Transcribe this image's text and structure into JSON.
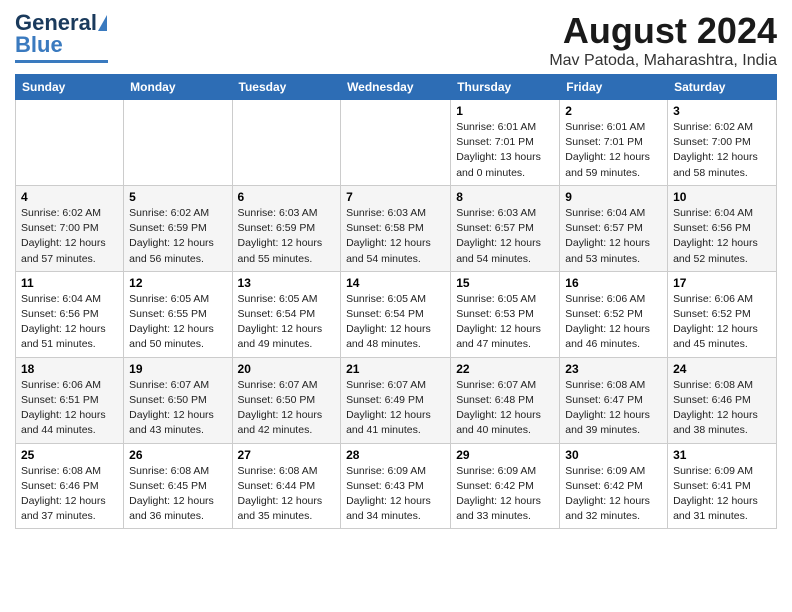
{
  "header": {
    "logo_general": "General",
    "logo_blue": "Blue",
    "month_year": "August 2024",
    "location": "Mav Patoda, Maharashtra, India"
  },
  "days_of_week": [
    "Sunday",
    "Monday",
    "Tuesday",
    "Wednesday",
    "Thursday",
    "Friday",
    "Saturday"
  ],
  "weeks": [
    [
      {
        "day": "",
        "info": ""
      },
      {
        "day": "",
        "info": ""
      },
      {
        "day": "",
        "info": ""
      },
      {
        "day": "",
        "info": ""
      },
      {
        "day": "1",
        "info": "Sunrise: 6:01 AM\nSunset: 7:01 PM\nDaylight: 13 hours\nand 0 minutes."
      },
      {
        "day": "2",
        "info": "Sunrise: 6:01 AM\nSunset: 7:01 PM\nDaylight: 12 hours\nand 59 minutes."
      },
      {
        "day": "3",
        "info": "Sunrise: 6:02 AM\nSunset: 7:00 PM\nDaylight: 12 hours\nand 58 minutes."
      }
    ],
    [
      {
        "day": "4",
        "info": "Sunrise: 6:02 AM\nSunset: 7:00 PM\nDaylight: 12 hours\nand 57 minutes."
      },
      {
        "day": "5",
        "info": "Sunrise: 6:02 AM\nSunset: 6:59 PM\nDaylight: 12 hours\nand 56 minutes."
      },
      {
        "day": "6",
        "info": "Sunrise: 6:03 AM\nSunset: 6:59 PM\nDaylight: 12 hours\nand 55 minutes."
      },
      {
        "day": "7",
        "info": "Sunrise: 6:03 AM\nSunset: 6:58 PM\nDaylight: 12 hours\nand 54 minutes."
      },
      {
        "day": "8",
        "info": "Sunrise: 6:03 AM\nSunset: 6:57 PM\nDaylight: 12 hours\nand 54 minutes."
      },
      {
        "day": "9",
        "info": "Sunrise: 6:04 AM\nSunset: 6:57 PM\nDaylight: 12 hours\nand 53 minutes."
      },
      {
        "day": "10",
        "info": "Sunrise: 6:04 AM\nSunset: 6:56 PM\nDaylight: 12 hours\nand 52 minutes."
      }
    ],
    [
      {
        "day": "11",
        "info": "Sunrise: 6:04 AM\nSunset: 6:56 PM\nDaylight: 12 hours\nand 51 minutes."
      },
      {
        "day": "12",
        "info": "Sunrise: 6:05 AM\nSunset: 6:55 PM\nDaylight: 12 hours\nand 50 minutes."
      },
      {
        "day": "13",
        "info": "Sunrise: 6:05 AM\nSunset: 6:54 PM\nDaylight: 12 hours\nand 49 minutes."
      },
      {
        "day": "14",
        "info": "Sunrise: 6:05 AM\nSunset: 6:54 PM\nDaylight: 12 hours\nand 48 minutes."
      },
      {
        "day": "15",
        "info": "Sunrise: 6:05 AM\nSunset: 6:53 PM\nDaylight: 12 hours\nand 47 minutes."
      },
      {
        "day": "16",
        "info": "Sunrise: 6:06 AM\nSunset: 6:52 PM\nDaylight: 12 hours\nand 46 minutes."
      },
      {
        "day": "17",
        "info": "Sunrise: 6:06 AM\nSunset: 6:52 PM\nDaylight: 12 hours\nand 45 minutes."
      }
    ],
    [
      {
        "day": "18",
        "info": "Sunrise: 6:06 AM\nSunset: 6:51 PM\nDaylight: 12 hours\nand 44 minutes."
      },
      {
        "day": "19",
        "info": "Sunrise: 6:07 AM\nSunset: 6:50 PM\nDaylight: 12 hours\nand 43 minutes."
      },
      {
        "day": "20",
        "info": "Sunrise: 6:07 AM\nSunset: 6:50 PM\nDaylight: 12 hours\nand 42 minutes."
      },
      {
        "day": "21",
        "info": "Sunrise: 6:07 AM\nSunset: 6:49 PM\nDaylight: 12 hours\nand 41 minutes."
      },
      {
        "day": "22",
        "info": "Sunrise: 6:07 AM\nSunset: 6:48 PM\nDaylight: 12 hours\nand 40 minutes."
      },
      {
        "day": "23",
        "info": "Sunrise: 6:08 AM\nSunset: 6:47 PM\nDaylight: 12 hours\nand 39 minutes."
      },
      {
        "day": "24",
        "info": "Sunrise: 6:08 AM\nSunset: 6:46 PM\nDaylight: 12 hours\nand 38 minutes."
      }
    ],
    [
      {
        "day": "25",
        "info": "Sunrise: 6:08 AM\nSunset: 6:46 PM\nDaylight: 12 hours\nand 37 minutes."
      },
      {
        "day": "26",
        "info": "Sunrise: 6:08 AM\nSunset: 6:45 PM\nDaylight: 12 hours\nand 36 minutes."
      },
      {
        "day": "27",
        "info": "Sunrise: 6:08 AM\nSunset: 6:44 PM\nDaylight: 12 hours\nand 35 minutes."
      },
      {
        "day": "28",
        "info": "Sunrise: 6:09 AM\nSunset: 6:43 PM\nDaylight: 12 hours\nand 34 minutes."
      },
      {
        "day": "29",
        "info": "Sunrise: 6:09 AM\nSunset: 6:42 PM\nDaylight: 12 hours\nand 33 minutes."
      },
      {
        "day": "30",
        "info": "Sunrise: 6:09 AM\nSunset: 6:42 PM\nDaylight: 12 hours\nand 32 minutes."
      },
      {
        "day": "31",
        "info": "Sunrise: 6:09 AM\nSunset: 6:41 PM\nDaylight: 12 hours\nand 31 minutes."
      }
    ]
  ]
}
